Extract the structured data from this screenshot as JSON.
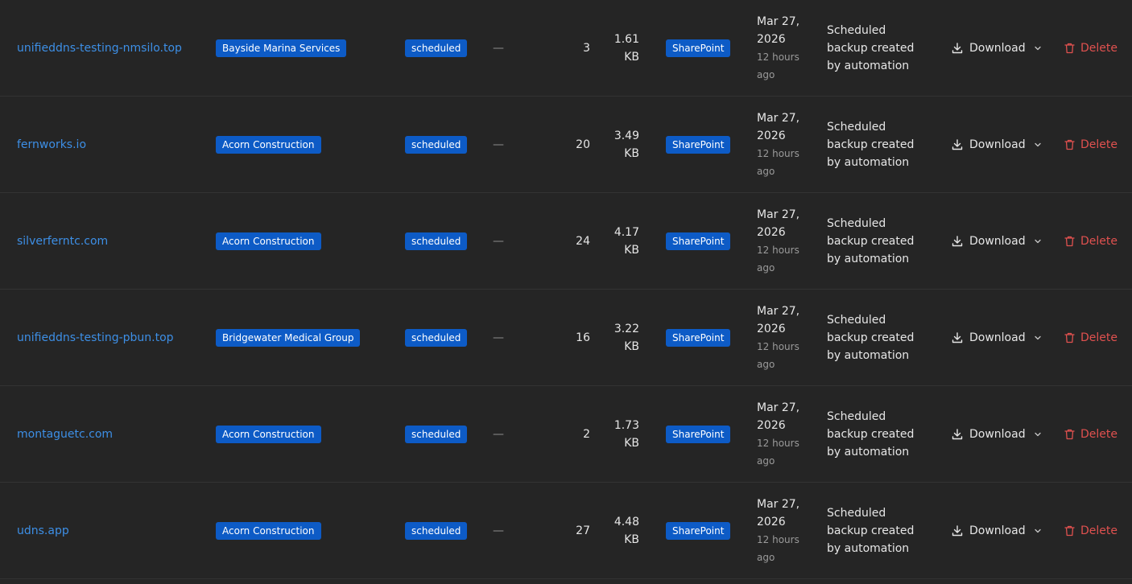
{
  "colors": {
    "background": "#252525",
    "link": "#3d8fe6",
    "badge": "#0d5bc6",
    "delete": "#e0514f",
    "divider": "#333333"
  },
  "icons": {
    "download": "download-icon",
    "chevron": "chevron-down-icon",
    "delete": "trash-icon"
  },
  "actions": {
    "download_label": "Download",
    "delete_label": "Delete"
  },
  "rows": [
    {
      "domain": "unifieddns-testing-nmsilo.top",
      "tenant": "Bayside Marina Services",
      "status": "scheduled",
      "dash": "—",
      "count": "3",
      "size_value": "1.61",
      "size_unit": "KB",
      "source": "SharePoint",
      "date_line1": "Mar 27,",
      "date_line2": "2026",
      "relative_line1": "12 hours",
      "relative_line2": "ago",
      "note_line1": "Scheduled",
      "note_line2": "backup created",
      "note_line3": "by automation"
    },
    {
      "domain": "fernworks.io",
      "tenant": "Acorn Construction",
      "status": "scheduled",
      "dash": "—",
      "count": "20",
      "size_value": "3.49",
      "size_unit": "KB",
      "source": "SharePoint",
      "date_line1": "Mar 27,",
      "date_line2": "2026",
      "relative_line1": "12 hours",
      "relative_line2": "ago",
      "note_line1": "Scheduled",
      "note_line2": "backup created",
      "note_line3": "by automation"
    },
    {
      "domain": "silverferntc.com",
      "tenant": "Acorn Construction",
      "status": "scheduled",
      "dash": "—",
      "count": "24",
      "size_value": "4.17",
      "size_unit": "KB",
      "source": "SharePoint",
      "date_line1": "Mar 27,",
      "date_line2": "2026",
      "relative_line1": "12 hours",
      "relative_line2": "ago",
      "note_line1": "Scheduled",
      "note_line2": "backup created",
      "note_line3": "by automation"
    },
    {
      "domain": "unifieddns-testing-pbun.top",
      "tenant": "Bridgewater Medical Group",
      "status": "scheduled",
      "dash": "—",
      "count": "16",
      "size_value": "3.22",
      "size_unit": "KB",
      "source": "SharePoint",
      "date_line1": "Mar 27,",
      "date_line2": "2026",
      "relative_line1": "12 hours",
      "relative_line2": "ago",
      "note_line1": "Scheduled",
      "note_line2": "backup created",
      "note_line3": "by automation"
    },
    {
      "domain": "montaguetc.com",
      "tenant": "Acorn Construction",
      "status": "scheduled",
      "dash": "—",
      "count": "2",
      "size_value": "1.73",
      "size_unit": "KB",
      "source": "SharePoint",
      "date_line1": "Mar 27,",
      "date_line2": "2026",
      "relative_line1": "12 hours",
      "relative_line2": "ago",
      "note_line1": "Scheduled",
      "note_line2": "backup created",
      "note_line3": "by automation"
    },
    {
      "domain": "udns.app",
      "tenant": "Acorn Construction",
      "status": "scheduled",
      "dash": "—",
      "count": "27",
      "size_value": "4.48",
      "size_unit": "KB",
      "source": "SharePoint",
      "date_line1": "Mar 27,",
      "date_line2": "2026",
      "relative_line1": "12 hours",
      "relative_line2": "ago",
      "note_line1": "Scheduled",
      "note_line2": "backup created",
      "note_line3": "by automation"
    }
  ]
}
